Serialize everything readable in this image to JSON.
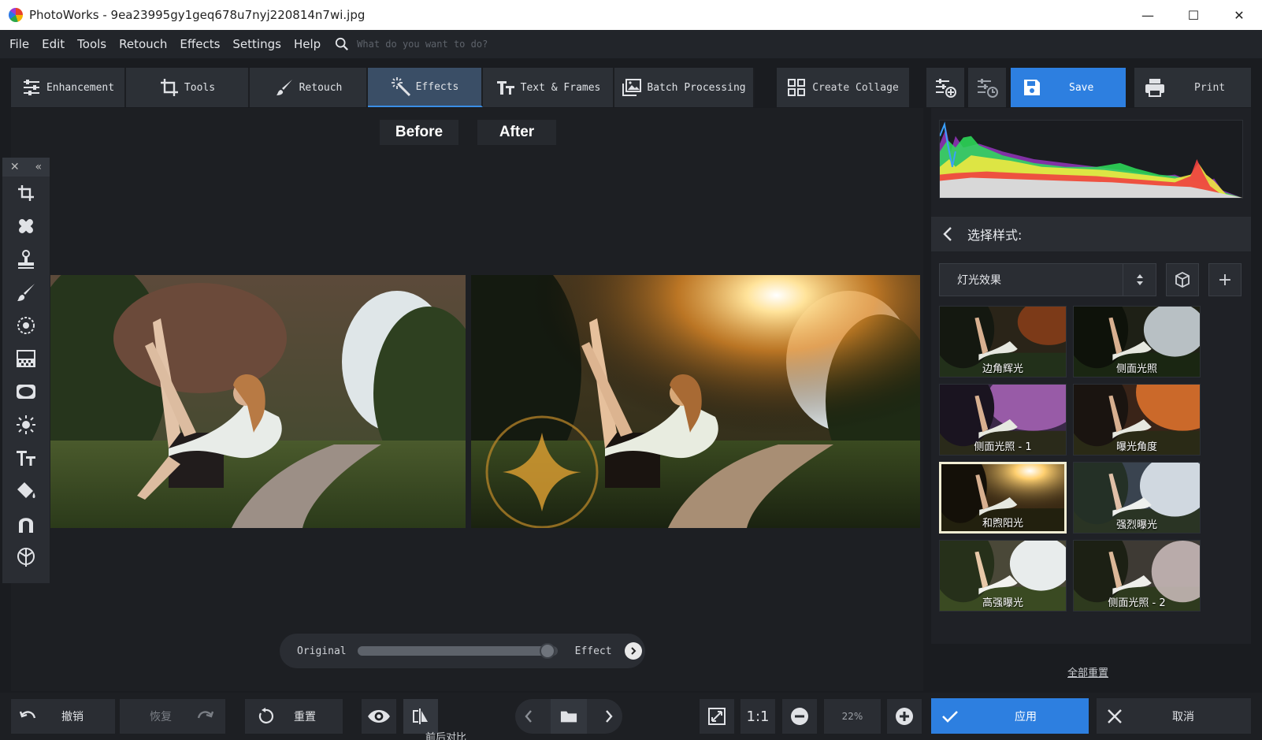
{
  "window": {
    "title": "PhotoWorks - 9ea23995gy1geq678u7nyj220814n7wi.jpg",
    "minimize": "—",
    "maximize": "☐",
    "close": "✕"
  },
  "menu": {
    "items": [
      "File",
      "Edit",
      "Tools",
      "Retouch",
      "Effects",
      "Settings",
      "Help"
    ],
    "search_placeholder": "What do you want to do?"
  },
  "tabs": [
    {
      "label": "Enhancement",
      "icon": "sliders-icon"
    },
    {
      "label": "Tools",
      "icon": "crop-icon"
    },
    {
      "label": "Retouch",
      "icon": "brush-icon"
    },
    {
      "label": "Effects",
      "icon": "magic-wand-icon",
      "active": true
    },
    {
      "label": "Text & Frames",
      "icon": "text-icon"
    },
    {
      "label": "Batch Processing",
      "icon": "images-icon"
    }
  ],
  "toolbar": {
    "collage_label": "Create Collage",
    "save_label": "Save",
    "print_label": "Print"
  },
  "canvas": {
    "before_label": "Before",
    "after_label": "After"
  },
  "slider": {
    "left_label": "Original",
    "right_label": "Effect",
    "value": 0.95
  },
  "bottom": {
    "undo_label": "撤销",
    "redo_label": "恢复",
    "reset_label": "重置",
    "compare_label": "前后对比",
    "fit_label": "1:1",
    "zoom_value": "22%",
    "apply_label": "应用",
    "cancel_label": "取消"
  },
  "panel": {
    "header_title": "选择样式:",
    "preset_value": "灯光效果",
    "add_symbol": "+",
    "reset_all_label": "全部重置",
    "thumbnails": [
      {
        "label": "边角辉光"
      },
      {
        "label": "侧面光照"
      },
      {
        "label": "侧面光照 - 1"
      },
      {
        "label": "曝光角度"
      },
      {
        "label": "和煦阳光",
        "selected": true
      },
      {
        "label": "强烈曝光"
      },
      {
        "label": "高强曝光"
      },
      {
        "label": "侧面光照 - 2"
      }
    ]
  },
  "colors": {
    "accent": "#2d7fe0",
    "panel_bg": "#2a2d33",
    "canvas_bg": "#1d1f23"
  }
}
